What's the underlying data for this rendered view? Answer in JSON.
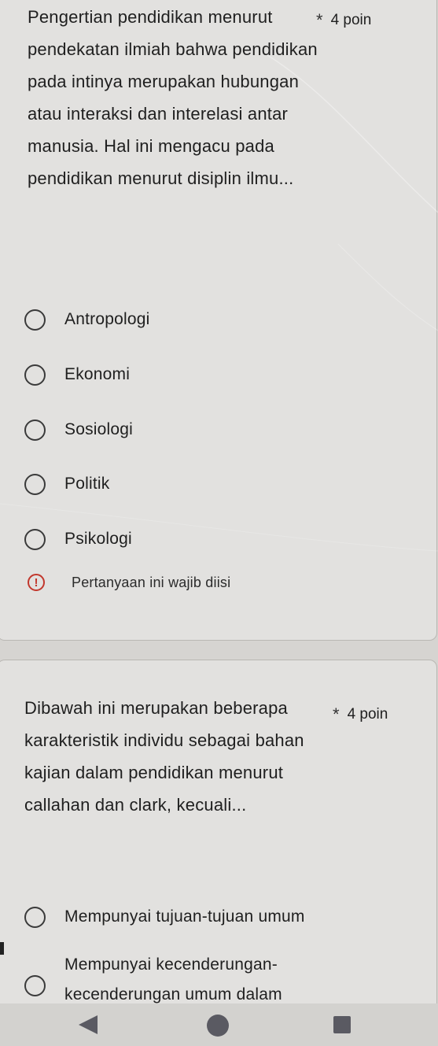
{
  "questions": [
    {
      "text": "Pengertian pendidikan menurut pendekatan ilmiah bahwa pendidikan pada intinya merupakan hubungan atau interaksi dan interelasi antar manusia. Hal ini mengacu pada pendidikan menurut disiplin ilmu...",
      "required_mark": "*",
      "points": "4 poin",
      "options": [
        "Antropologi",
        "Ekonomi",
        "Sosiologi",
        "Politik",
        "Psikologi"
      ],
      "validation": {
        "icon": "!",
        "message": "Pertanyaan ini wajib diisi"
      }
    },
    {
      "text": "Dibawah ini merupakan beberapa karakteristik individu sebagai bahan kajian dalam pendidikan menurut callahan dan clark, kecuali...",
      "required_mark": "*",
      "points": "4 poin",
      "options": [
        "Mempunyai tujuan-tujuan umum",
        "Mempunyai kecenderungan-kecenderungan umum dalam"
      ]
    }
  ],
  "colors": {
    "card_background": "#e2e1df",
    "page_background": "#d6d4d1",
    "error_red": "#c2372c",
    "nav_icons": "#5a5a62"
  },
  "nav": {
    "back_icon": "back-triangle-icon",
    "home_icon": "home-circle-icon",
    "recents_icon": "recents-square-icon"
  }
}
